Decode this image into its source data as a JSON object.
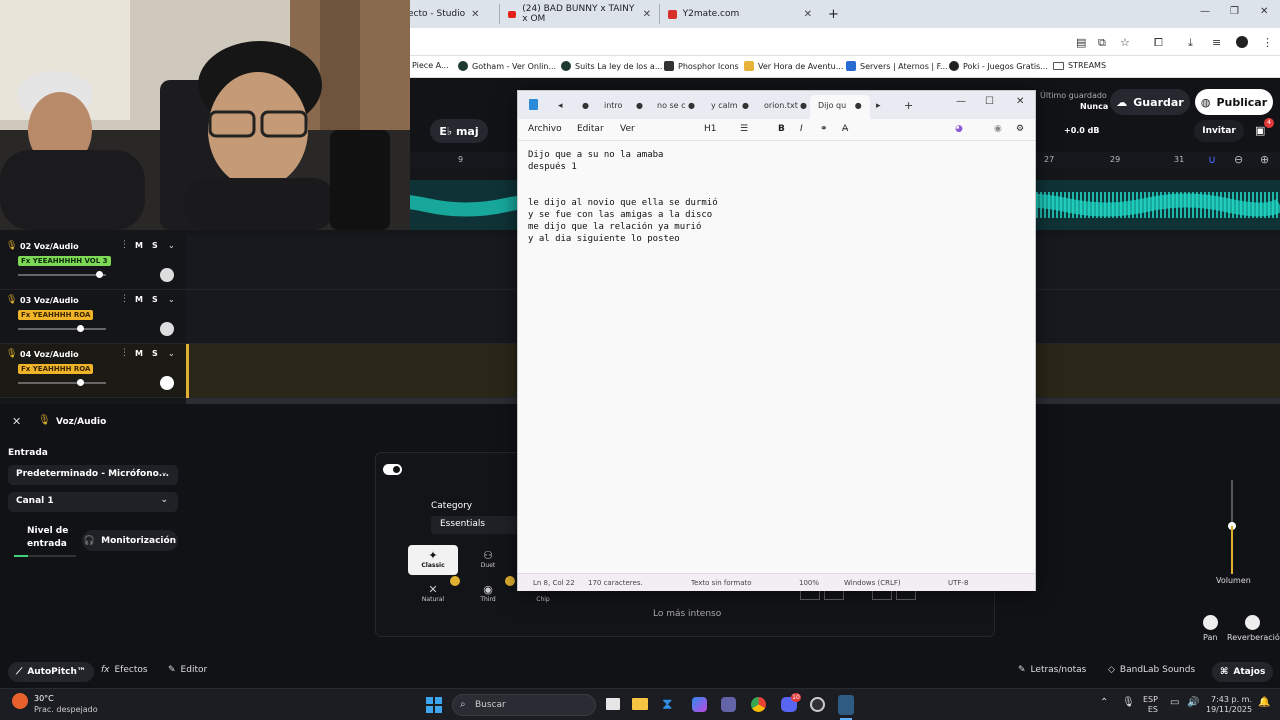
{
  "browser": {
    "tabs": [
      {
        "label": "ecto - Studio"
      },
      {
        "label": "(24) BAD BUNNY x TAINY x OM"
      },
      {
        "label": "Y2mate.com"
      }
    ],
    "new_tab_symbol": "+",
    "bookmarks": [
      {
        "label": "Piece A..."
      },
      {
        "label": "Gotham - Ver Onlin..."
      },
      {
        "label": "Suits La ley de los a..."
      },
      {
        "label": "Phosphor Icons"
      },
      {
        "label": "Ver Hora de Aventu..."
      },
      {
        "label": "Servers | Aternos | F..."
      },
      {
        "label": "Poki - Juegos Gratis..."
      },
      {
        "label": "STREAMS"
      }
    ]
  },
  "daw": {
    "last_saved_label": "Último guardado",
    "last_saved_value": "Nunca",
    "save_label": "Guardar",
    "publish_label": "Publicar",
    "invite_label": "Invitar",
    "notification_count": "4",
    "key_label": "E♭ maj",
    "master_gain": "+0.0 dB",
    "ruler_marks": [
      "9",
      "27",
      "29",
      "31"
    ],
    "tracks": [
      {
        "name": "02  Voz/Audio",
        "fx": "Fx YEEAHHHHH VOL 3",
        "m": "M",
        "s": "S",
        "fx_color": "#7ed957",
        "fx_text": "#0b2a07",
        "fader": 0.93
      },
      {
        "name": "03  Voz/Audio",
        "fx": "Fx YEAHHHH ROA",
        "m": "M",
        "s": "S",
        "fx_color": "#f0b429",
        "fx_text": "#3a2600",
        "fader": 0.71
      },
      {
        "name": "04  Voz/Audio",
        "fx": "Fx YEAHHHH ROA",
        "m": "M",
        "s": "S",
        "fx_color": "#f0b429",
        "fx_text": "#3a2600",
        "fader": 0.71
      }
    ],
    "panel": {
      "title": "Voz/Audio",
      "input_label": "Entrada",
      "input_device": "Predeterminado - Micrófono...",
      "channel": "Canal 1",
      "level_label": "Nivel de entrada",
      "monitor_label": "Monitorización",
      "category_label": "Category",
      "category_value": "Essentials",
      "presets": [
        "Classic",
        "Duet",
        "Natural",
        "Third",
        "Chip"
      ],
      "loudest_label": "Lo más intenso",
      "volume_label": "Volumen",
      "pan_label": "Pan",
      "reverb_label": "Reverberación"
    },
    "bottom_bar": {
      "autopitch": "AutoPitch™",
      "effects": "Efectos",
      "editor": "Editor",
      "lyrics": "Letras/notas",
      "sounds": "BandLab Sounds",
      "shortcuts": "Atajos"
    }
  },
  "notepad": {
    "tabs": [
      "intro",
      "no se c",
      "y calm",
      "orion.txt",
      "Dijo qu"
    ],
    "menu": [
      "Archivo",
      "Editar",
      "Ver"
    ],
    "heading_style": "H1",
    "lines": [
      "Dijo que a su no la amaba",
      "después 1",
      "",
      "",
      "le dijo al novio que ella se durmió",
      "y se fue con las amigas a la disco",
      "me dijo que la relación ya murió",
      "y al dia siguiente lo posteo"
    ],
    "status": {
      "position": "Ln 8, Col 22",
      "chars": "170 caracteres.",
      "format": "Texto sin formato",
      "zoom": "100%",
      "line_endings": "Windows (CRLF)",
      "encoding": "UTF-8"
    }
  },
  "taskbar": {
    "weather_temp": "30°C",
    "weather_desc": "Prac. despejado",
    "search_placeholder": "Buscar",
    "lang1": "ESP",
    "lang2": "ES",
    "time": "7:43 p. m.",
    "date": "19/11/2025",
    "discord_badge": "10"
  }
}
